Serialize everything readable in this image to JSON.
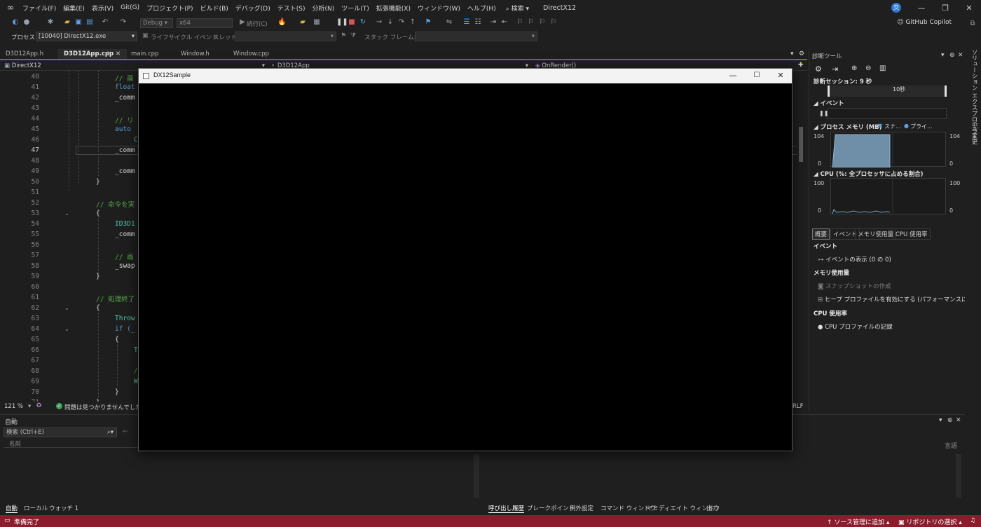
{
  "menubar": {
    "items": [
      "ファイル(F)",
      "編集(E)",
      "表示(V)",
      "Git(G)",
      "プロジェクト(P)",
      "ビルド(B)",
      "デバッグ(D)",
      "テスト(S)",
      "分析(N)",
      "ツール(T)",
      "拡張機能(X)",
      "ウィンドウ(W)",
      "ヘルプ(H)"
    ],
    "search_label": "検索",
    "solution_name": "DirectX12",
    "avatar_letter": "交"
  },
  "toolbar": {
    "config": "Debug",
    "platform": "x64",
    "continue_label": "続行(C)",
    "github_copilot": "GitHub Copilot"
  },
  "toolbar2": {
    "process_label": "プロセス:",
    "process_value": "[10040] DirectX12.exe",
    "lifecycle_label": "ライフサイクル イベント",
    "thread_label": "スレッド:",
    "stack_frame_label": "スタック フレーム:"
  },
  "doc_tabs": [
    "D3D12App.h",
    "D3D12App.cpp",
    "main.cpp",
    "Window.h",
    "Window.cpp"
  ],
  "nav": {
    "project": "DirectX12",
    "class": "D3D12App",
    "method": "OnRender()"
  },
  "code_lines": [
    {
      "n": "40",
      "text": "// 画"
    },
    {
      "n": "41",
      "text": "float"
    },
    {
      "n": "42",
      "text": "_comm"
    },
    {
      "n": "43",
      "text": ""
    },
    {
      "n": "44",
      "text": "// リ"
    },
    {
      "n": "45",
      "text": "auto "
    },
    {
      "n": "46",
      "text": "C"
    },
    {
      "n": "47",
      "text": "_comm"
    },
    {
      "n": "48",
      "text": ""
    },
    {
      "n": "49",
      "text": "_comm"
    },
    {
      "n": "50",
      "text": "}"
    },
    {
      "n": "51",
      "text": ""
    },
    {
      "n": "52",
      "text": "// 命令を実"
    },
    {
      "n": "53",
      "text": "{"
    },
    {
      "n": "54",
      "text": "ID3D1"
    },
    {
      "n": "55",
      "text": "_comm"
    },
    {
      "n": "56",
      "text": ""
    },
    {
      "n": "57",
      "text": "// 画"
    },
    {
      "n": "58",
      "text": "_swap"
    },
    {
      "n": "59",
      "text": "}"
    },
    {
      "n": "60",
      "text": ""
    },
    {
      "n": "61",
      "text": "// 処理終了"
    },
    {
      "n": "62",
      "text": "{"
    },
    {
      "n": "63",
      "text": "Throw"
    },
    {
      "n": "64",
      "text": "if (_"
    },
    {
      "n": "65",
      "text": "{"
    },
    {
      "n": "66",
      "text": "T"
    },
    {
      "n": "67",
      "text": ""
    },
    {
      "n": "68",
      "text": "/"
    },
    {
      "n": "69",
      "text": "W"
    },
    {
      "n": "70",
      "text": "}"
    },
    {
      "n": "71",
      "text": "}"
    }
  ],
  "editor_status": {
    "zoom": "121 %",
    "issues": "問題は見つかりませんでした",
    "line_ending": "RLF"
  },
  "auto_panel": {
    "title": "自動",
    "search_placeholder": "検索 (Ctrl+E)",
    "col_name": "名前",
    "col_lang": "言語"
  },
  "bottom_tabs_left": [
    "自動",
    "ローカル",
    "ウォッチ 1"
  ],
  "bottom_tabs_right": [
    "呼び出し履歴",
    "ブレークポイント",
    "例外設定",
    "コマンド ウィンドウ",
    "イミディエイト ウィンドウ",
    "出力"
  ],
  "statusbar": {
    "ready": "準備完了",
    "source_control": "ソース管理に追加",
    "repo_select": "リポジトリの選択"
  },
  "diagnostics": {
    "title": "診断ツール",
    "session": "診断セッション: 9 秒",
    "timeline_label": "10秒",
    "events_section": "イベント",
    "memory_section": "プロセス メモリ (MB)",
    "memory_legend_snapshot": "スナ...",
    "memory_legend_private": "プライ...",
    "mem_max": "104",
    "mem_min": "0",
    "mem_value_fraction": 0.98,
    "cpu_section": "CPU (%: 全プロセッサに占める割合)",
    "cpu_max": "100",
    "cpu_min": "0",
    "tabs": [
      "概要",
      "イベント",
      "メモリ使用量",
      "CPU 使用率"
    ],
    "ev_head": "イベント",
    "ev_show": "イベントの表示 (0 の 0)",
    "mem_head": "メモリ使用量",
    "mem_snapshot": "スナップショットの作成",
    "mem_heap": "ヒープ プロファイルを有効にする (パフォーマンスに影響します)",
    "cpu_head": "CPU 使用率",
    "cpu_record": "CPU プロファイルの記録"
  },
  "side_strip": [
    "ソリューション エクスプローラー",
    "Git 変更"
  ],
  "dx_window": {
    "title": "DX12Sample"
  }
}
